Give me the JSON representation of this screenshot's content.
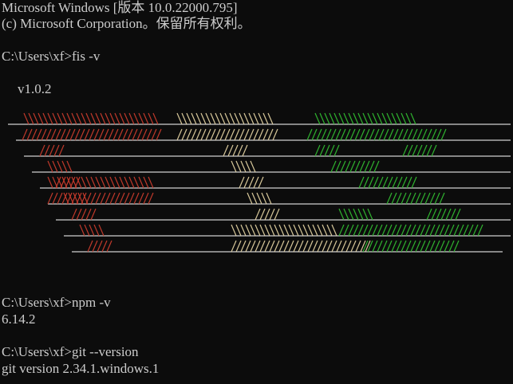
{
  "window": {
    "background": "#0c0c0c",
    "text_color": "#cccccc"
  },
  "header": {
    "line1": "Microsoft Windows [版本 10.0.22000.795]",
    "line2": "(c) Microsoft Corporation。保留所有权利。"
  },
  "session": [
    {
      "prompt": "C:\\Users\\xf>",
      "command": "fis -v",
      "output": "v1.0.2"
    },
    {
      "prompt": "C:\\Users\\xf>",
      "command": "npm -v",
      "output": "6.14.2"
    },
    {
      "prompt": "C:\\Users\\xf>",
      "command": "git --version",
      "output": "git version 2.34.1.windows.1"
    }
  ],
  "banner": {
    "name": "fis-ascii-logo",
    "colors": {
      "f": "#c0392b",
      "i": "#d8c89a",
      "s": "#2fb32f",
      "underline": "#cfcfcf"
    }
  }
}
